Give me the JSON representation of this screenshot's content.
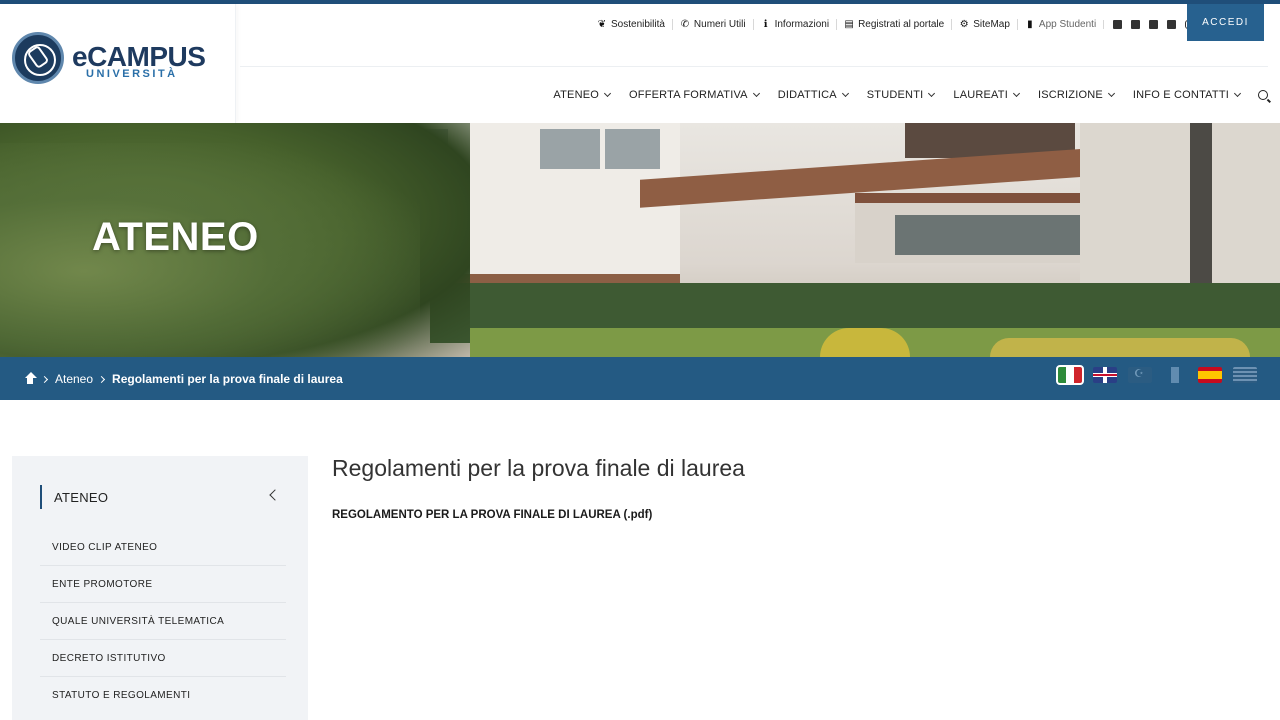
{
  "brand": {
    "name": "eCAMPUS",
    "subtitle": "UNIVERSITÀ"
  },
  "utility_nav": [
    {
      "label": "Sostenibilità",
      "icon": "leaf-icon"
    },
    {
      "label": "Numeri Utili",
      "icon": "phone-icon"
    },
    {
      "label": "Informazioni",
      "icon": "info-icon"
    },
    {
      "label": "Registrati al portale",
      "icon": "id-card-icon"
    },
    {
      "label": "SiteMap",
      "icon": "sitemap-icon"
    },
    {
      "label": "App Studenti",
      "icon": "mobile-icon"
    }
  ],
  "social": [
    "facebook-icon",
    "twitter-icon",
    "youtube-icon",
    "linkedin-icon",
    "instagram-icon"
  ],
  "login_label": "ACCEDI",
  "main_nav": [
    "ATENEO",
    "OFFERTA FORMATIVA",
    "DIDATTICA",
    "STUDENTI",
    "LAUREATI",
    "ISCRIZIONE",
    "INFO E CONTATTI"
  ],
  "hero": {
    "title": "ATENEO"
  },
  "breadcrumb": {
    "parent": "Ateneo",
    "current": "Regolamenti per la prova finale di laurea"
  },
  "languages": [
    {
      "code": "it",
      "name": "Italiano",
      "active": true
    },
    {
      "code": "en",
      "name": "English",
      "active": false
    },
    {
      "code": "tr",
      "name": "Türkçe",
      "active": false
    },
    {
      "code": "fr",
      "name": "Français",
      "active": false
    },
    {
      "code": "es",
      "name": "Español",
      "active": false
    },
    {
      "code": "el",
      "name": "Ελληνικά",
      "active": false
    }
  ],
  "sidebar": {
    "heading": "ATENEO",
    "items": [
      {
        "label": "VIDEO CLIP ATENEO"
      },
      {
        "label": "ENTE PROMOTORE"
      },
      {
        "label": "QUALE UNIVERSITÀ TELEMATICA"
      },
      {
        "label": "DECRETO ISTITUTIVO"
      },
      {
        "label": "STATUTO E REGOLAMENTI"
      }
    ]
  },
  "content": {
    "title": "Regolamenti per la prova finale di laurea",
    "document_link": "REGOLAMENTO PER LA PROVA FINALE DI LAUREA (.pdf)"
  },
  "colors": {
    "primary": "#245a83",
    "brand_dark": "#1e3a5f",
    "sidebar_bg": "#f1f3f6"
  }
}
